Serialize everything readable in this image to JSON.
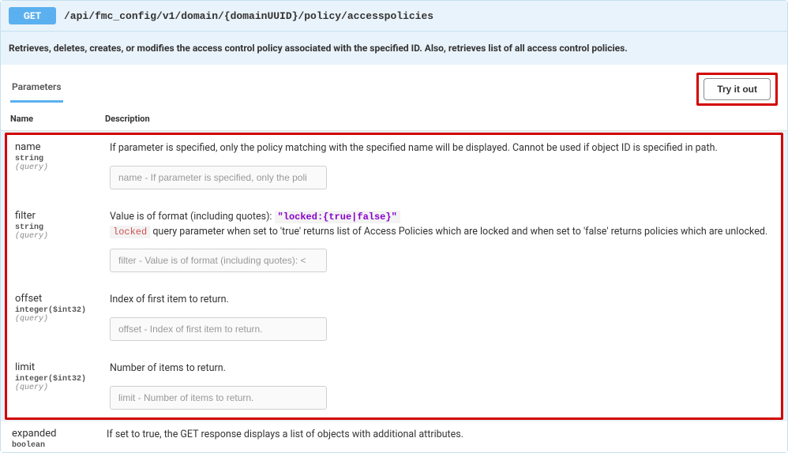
{
  "endpoint": {
    "method": "GET",
    "path": "/api/fmc_config/v1/domain/{domainUUID}/policy/accesspolicies",
    "summary": "Retrieves, deletes, creates, or modifies the access control policy associated with the specified ID. Also, retrieves list of all access control policies."
  },
  "tabs": {
    "parameters_label": "Parameters",
    "tryout_label": "Try it out"
  },
  "columns": {
    "name": "Name",
    "description": "Description"
  },
  "params": [
    {
      "name": "name",
      "type": "string",
      "loc": "(query)",
      "desc_plain": "If parameter is specified, only the policy matching with the specified name will be displayed. Cannot be used if object ID is specified in path.",
      "placeholder": "name - If parameter is specified, only the poli"
    },
    {
      "name": "filter",
      "type": "string",
      "loc": "(query)",
      "desc_prefix": "Value is of format (including quotes): ",
      "code_sample": "\"locked:{true|false}\"",
      "code_word": "locked",
      "desc_suffix": " query parameter when set to 'true' returns list of Access Policies which are locked and when set to 'false' returns policies which are unlocked.",
      "placeholder": "filter - Value is of format (including quotes): <"
    },
    {
      "name": "offset",
      "type": "integer($int32)",
      "loc": "(query)",
      "desc_plain": "Index of first item to return.",
      "placeholder": "offset - Index of first item to return."
    },
    {
      "name": "limit",
      "type": "integer($int32)",
      "loc": "(query)",
      "desc_plain": "Number of items to return.",
      "placeholder": "limit - Number of items to return."
    }
  ],
  "params_extra": {
    "name": "expanded",
    "type": "boolean",
    "desc_plain": "If set to true, the GET response displays a list of objects with additional attributes."
  }
}
